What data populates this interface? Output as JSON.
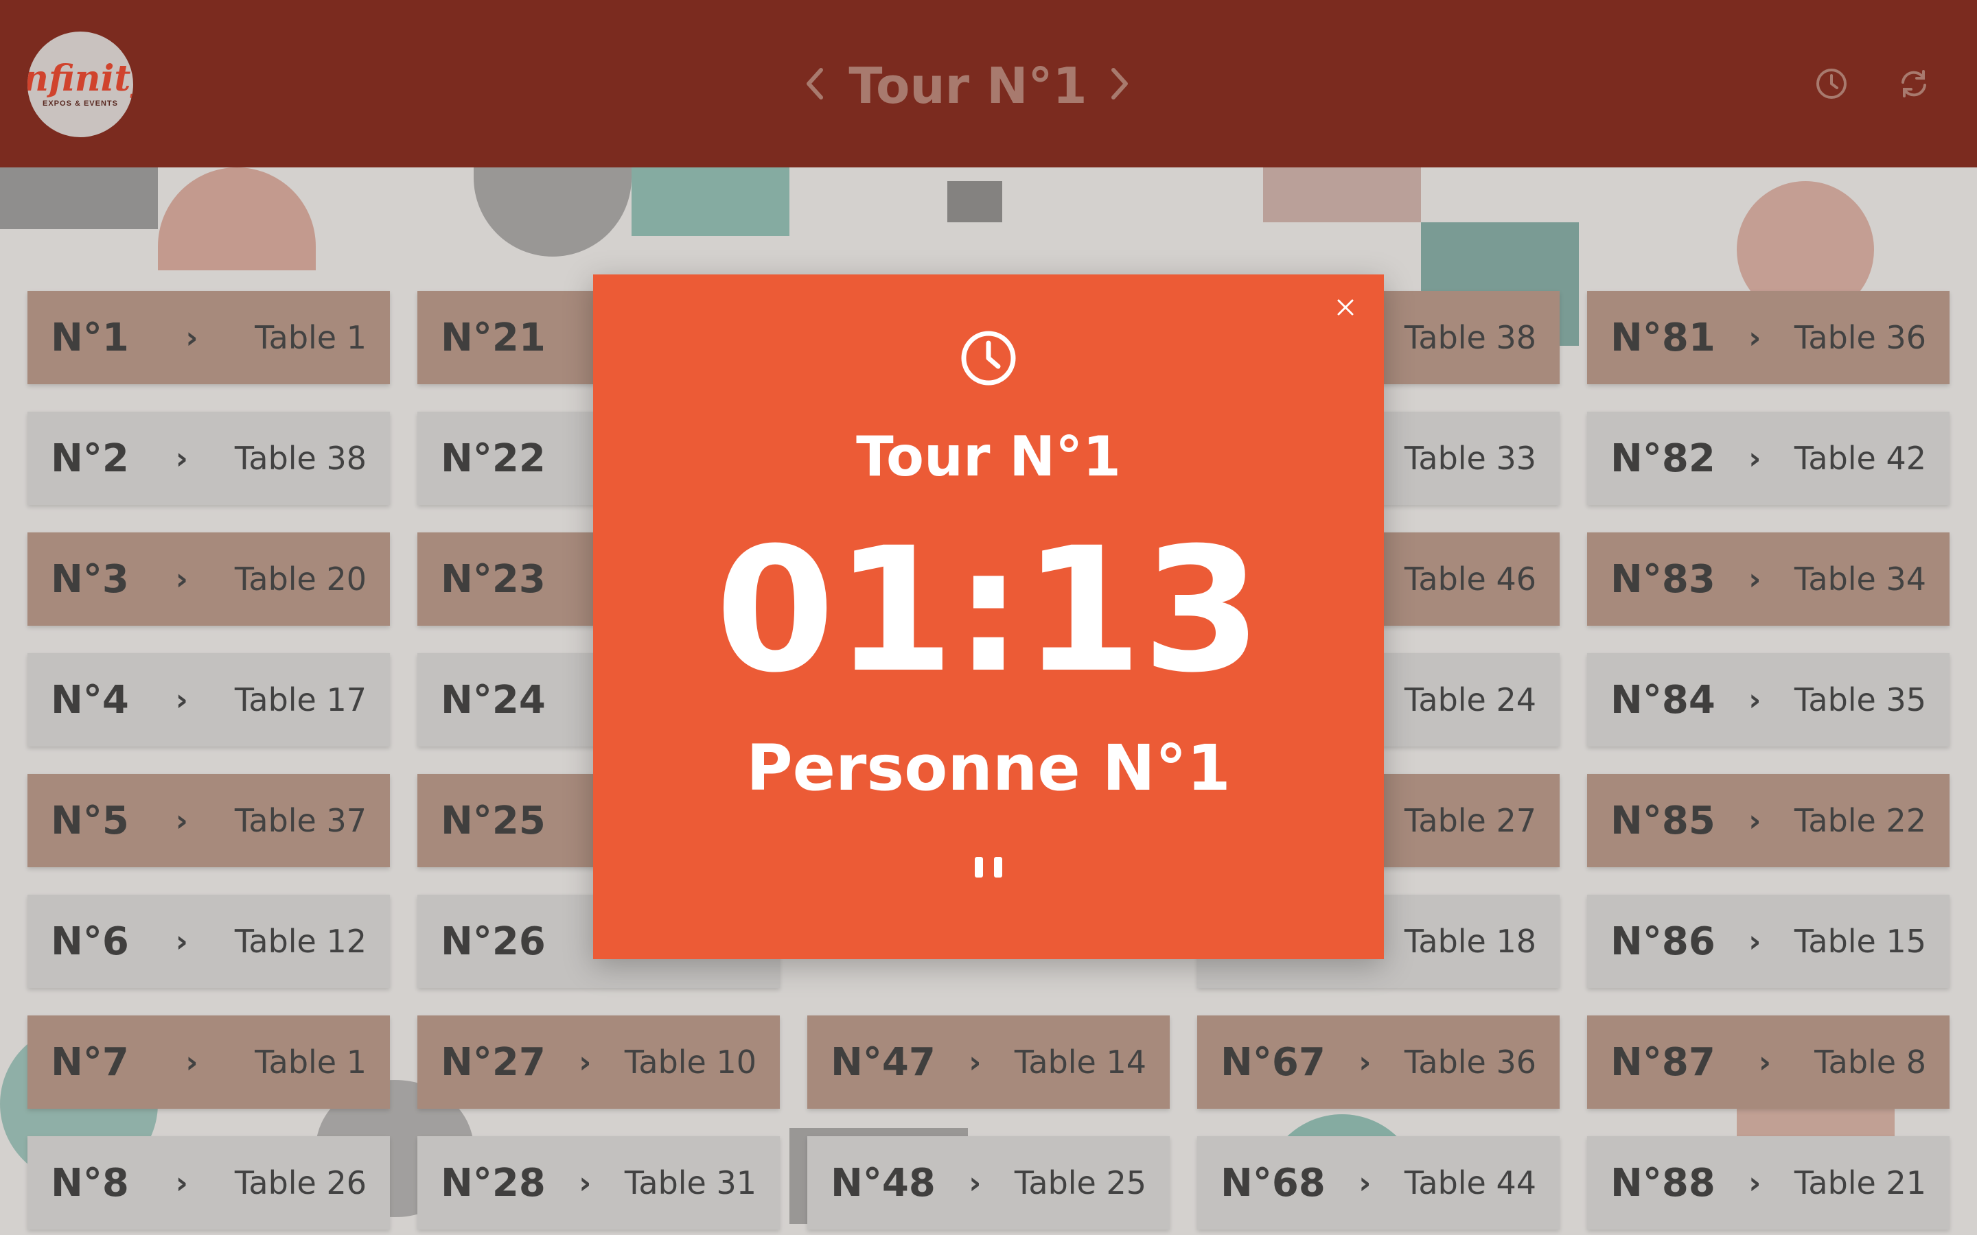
{
  "header": {
    "logo_word": "infinity",
    "logo_sub": "EXPOS & EVENTS",
    "title": "Tour N°1",
    "prev_icon": "chevron-left-icon",
    "next_icon": "chevron-right-icon",
    "timer_icon": "clock-icon",
    "refresh_icon": "refresh-icon",
    "color": "#7b2b1f"
  },
  "cards": [
    {
      "num": "N°1",
      "table": "Table 1"
    },
    {
      "num": "N°2",
      "table": "Table 38"
    },
    {
      "num": "N°3",
      "table": "Table 20"
    },
    {
      "num": "N°4",
      "table": "Table 17"
    },
    {
      "num": "N°5",
      "table": "Table 37"
    },
    {
      "num": "N°6",
      "table": "Table 12"
    },
    {
      "num": "N°7",
      "table": "Table 1"
    },
    {
      "num": "N°8",
      "table": "Table 26"
    },
    {
      "num": "N°21",
      "table": ""
    },
    {
      "num": "N°22",
      "table": ""
    },
    {
      "num": "N°23",
      "table": ""
    },
    {
      "num": "N°24",
      "table": ""
    },
    {
      "num": "N°25",
      "table": ""
    },
    {
      "num": "N°26",
      "table": ""
    },
    {
      "num": "N°27",
      "table": "Table 10"
    },
    {
      "num": "N°28",
      "table": "Table 31"
    },
    {
      "num": "N°47",
      "table": "Table 14"
    },
    {
      "num": "N°48",
      "table": "Table 25"
    },
    {
      "num": "",
      "table": "Table 38"
    },
    {
      "num": "",
      "table": "Table 33"
    },
    {
      "num": "",
      "table": "Table 46"
    },
    {
      "num": "",
      "table": "Table 24"
    },
    {
      "num": "",
      "table": "Table 27"
    },
    {
      "num": "",
      "table": "Table 18"
    },
    {
      "num": "N°67",
      "table": "Table 36"
    },
    {
      "num": "N°68",
      "table": "Table 44"
    },
    {
      "num": "N°81",
      "table": "Table 36"
    },
    {
      "num": "N°82",
      "table": "Table 42"
    },
    {
      "num": "N°83",
      "table": "Table 34"
    },
    {
      "num": "N°84",
      "table": "Table 35"
    },
    {
      "num": "N°85",
      "table": "Table 22"
    },
    {
      "num": "N°86",
      "table": "Table 15"
    },
    {
      "num": "N°87",
      "table": "Table 8"
    },
    {
      "num": "N°88",
      "table": "Table 21"
    }
  ],
  "modal": {
    "icon": "clock-icon",
    "tour": "Tour N°1",
    "time": "01:13",
    "person": "Personne N°1",
    "close_icon": "close-icon",
    "pause_icon": "pause-icon",
    "color": "#ec5b36"
  },
  "colors": {
    "card_alt": "#ad8672",
    "card": "#d5d2cf"
  }
}
